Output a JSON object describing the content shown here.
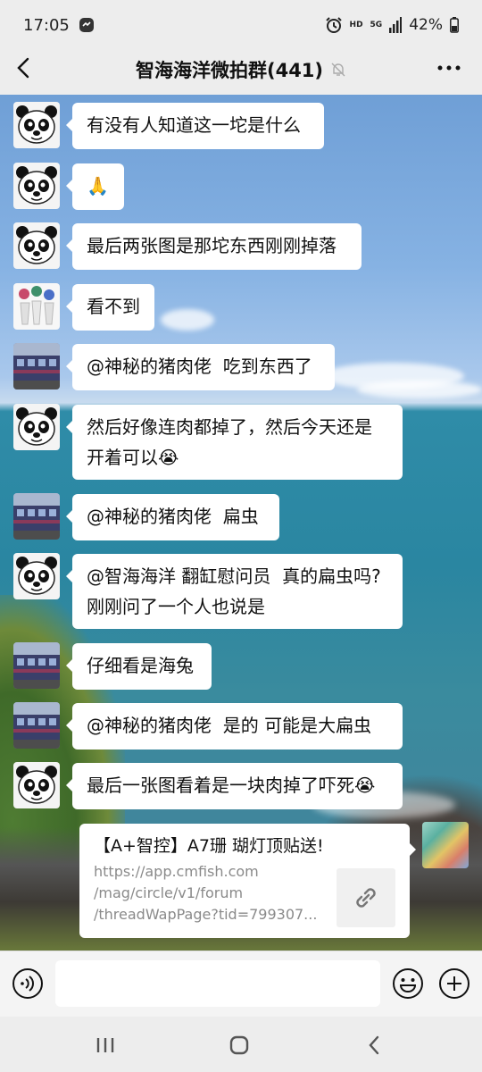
{
  "status_bar": {
    "time": "17:05",
    "battery": "42%",
    "hd": "HD",
    "signal_label": "5G"
  },
  "header": {
    "title": "智海海洋微拍群(441)"
  },
  "messages": [
    {
      "sender": "panda",
      "text": "有没有人知道这一坨是什么"
    },
    {
      "sender": "panda",
      "text": "🙏"
    },
    {
      "sender": "panda",
      "text": "最后两张图是那坨东西刚刚掉落"
    },
    {
      "sender": "flowers",
      "text": "看不到"
    },
    {
      "sender": "building",
      "text": "@神秘的猪肉佬  吃到东西了"
    },
    {
      "sender": "panda",
      "text": "然后好像连肉都掉了，然后今天还是\n开着可以😭"
    },
    {
      "sender": "building",
      "text": "@神秘的猪肉佬  扁虫"
    },
    {
      "sender": "panda",
      "text": "@智海海洋 翻缸慰问员  真的扁虫吗?\n刚刚问了一个人也说是"
    },
    {
      "sender": "building",
      "text": "仔细看是海兔"
    },
    {
      "sender": "building",
      "text": "@神秘的猪肉佬  是的 可能是大扁虫"
    },
    {
      "sender": "panda",
      "text": "最后一张图看着是一块肉掉了吓死😭"
    }
  ],
  "link_card": {
    "title": "【A+智控】A7珊 瑚灯顶贴送!",
    "url": "https://app.cmfish.com\n/mag/circle/v1/forum\n/threadWapPage?tid=799307..."
  },
  "colors": {
    "background": "#ededed",
    "bubble": "#ffffff",
    "link_gray": "#8a8a8a"
  }
}
